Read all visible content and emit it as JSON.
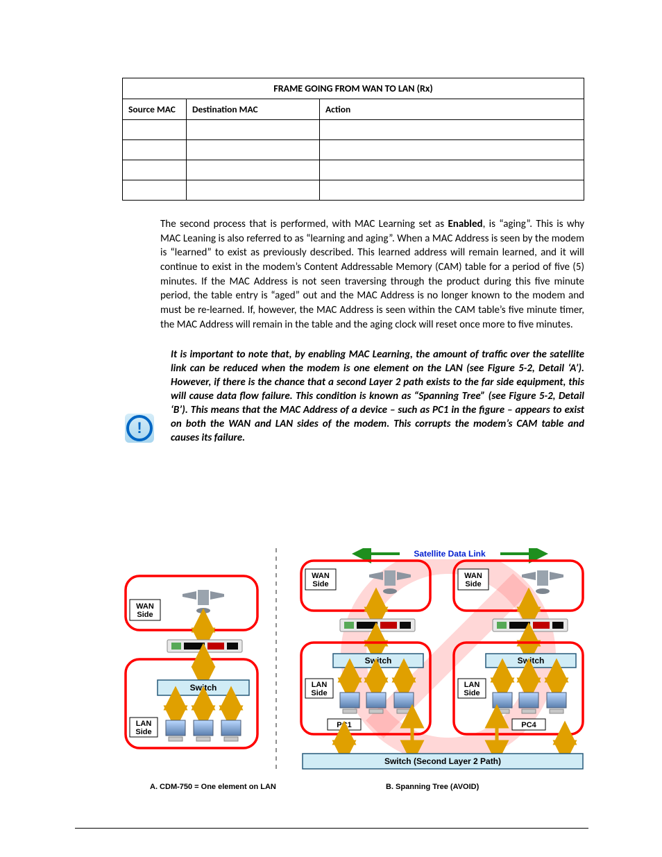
{
  "table": {
    "title": "FRAME GOING FROM WAN TO LAN (Rx)",
    "headers": {
      "src": "Source MAC",
      "dst": "Destination MAC",
      "act": "Action"
    },
    "rows": [
      {
        "src": "",
        "dst": "",
        "act": ""
      },
      {
        "src": "",
        "dst": "",
        "act": ""
      },
      {
        "src": "",
        "dst": "",
        "act": ""
      },
      {
        "src": "",
        "dst": "",
        "act": ""
      }
    ]
  },
  "para1": {
    "t1": "The second process that is performed, with MAC Learning set as ",
    "bold": "Enabled",
    "t2": ", is “aging”. This is why MAC Leaning is also referred to as “learning and aging”. When a MAC Address is seen by the modem is “learned” to exist as previously described. This learned address will remain learned, and it will continue to exist in the modem’s Content Addressable Memory (CAM) table for a period of five (5) minutes. If the MAC Address is not seen traversing through the product during this five minute period, the table entry is “aged” out and the MAC Address is no longer known to the modem and must be re-learned. If, however, the MAC Address is seen within the CAM table’s five minute timer, the MAC Address will remain in the table and the aging clock will reset once more to five minutes."
  },
  "note": "It is important to note that, by enabling MAC Learning, the amount of traffic over the satellite link can be reduced when the modem is one element on the LAN (see Figure 5-2, Detail ‘A’). However, if there is the chance that a second Layer 2 path exists to the far side equipment, this will cause data flow failure. This condition is known as “Spanning Tree” (see Figure 5-2, Detail ‘B’). This means that the MAC Address of a device – such as PC1 in the figure – appears to exist on both the WAN and LAN sides of the modem. This corrupts the modem’s CAM table and causes its failure.",
  "diagram": {
    "A": {
      "wan": "WAN\nSide",
      "lan": "LAN\nSide",
      "switch": "Switch"
    },
    "B": {
      "sat": "Satellite Data Link",
      "wan": "WAN\nSide",
      "lan": "LAN\nSide",
      "switch": "Switch",
      "pc1": "PC1",
      "pc4": "PC4",
      "l2": "Switch (Second Layer 2 Path)"
    }
  },
  "captions": {
    "a": "A. CDM-750 = One element on LAN",
    "b": "B. Spanning Tree (AVOID)"
  }
}
